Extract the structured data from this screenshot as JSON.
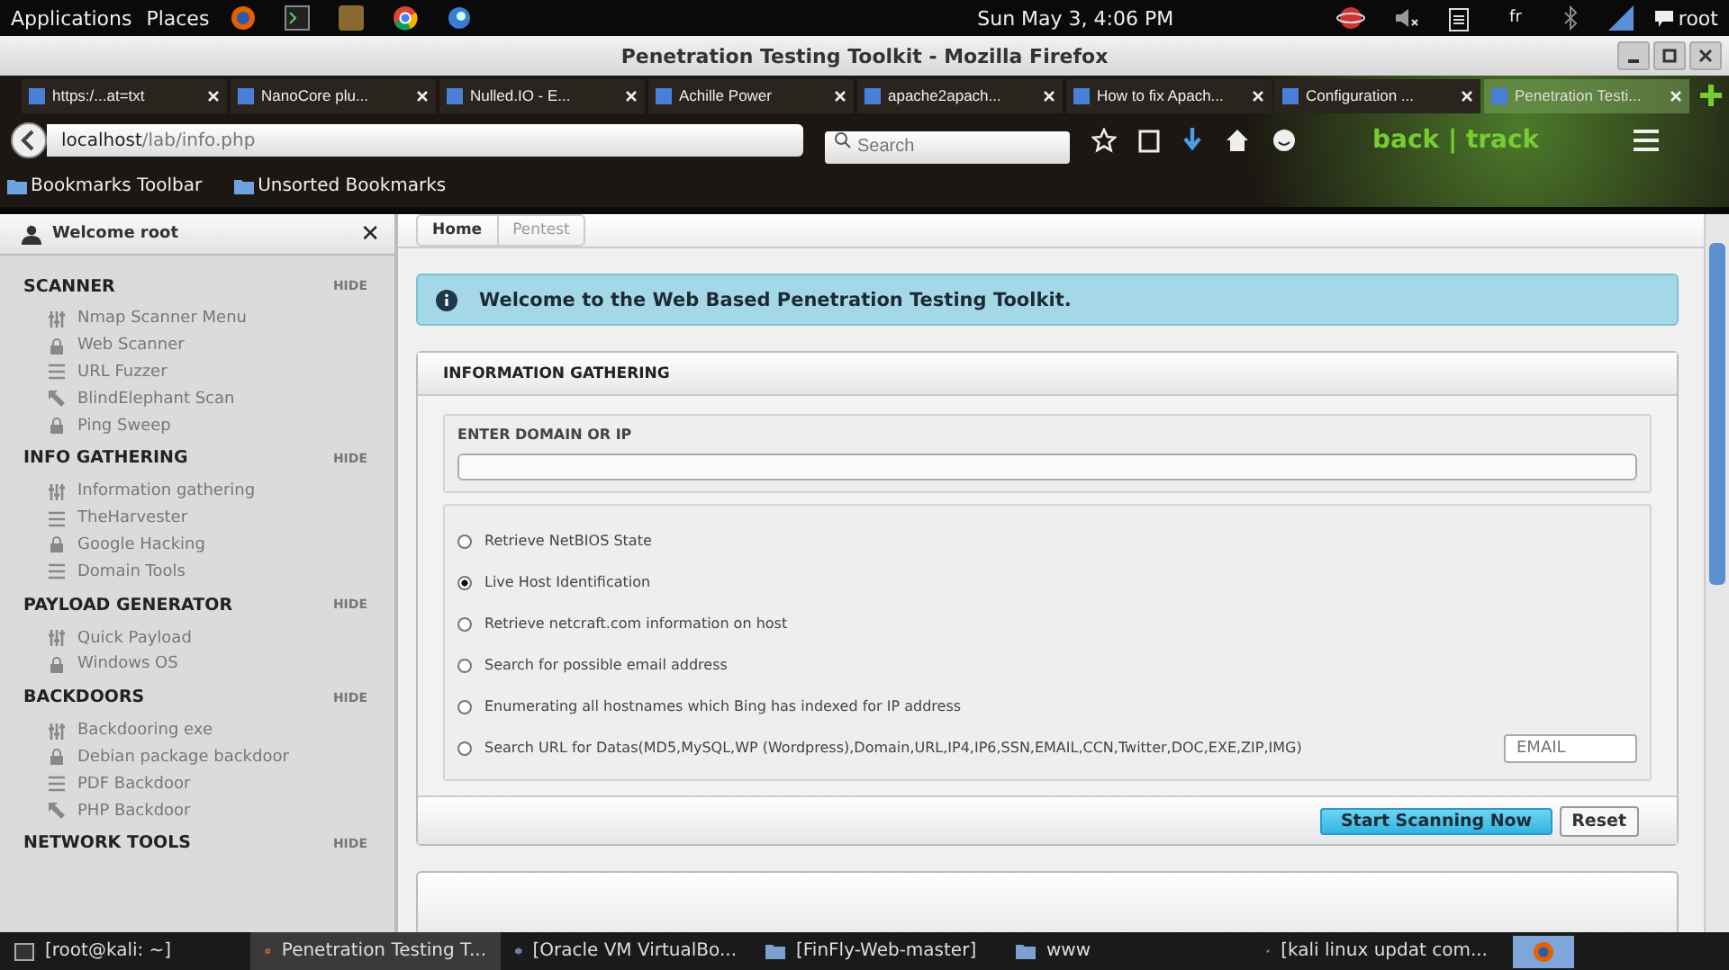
{
  "top_panel": {
    "menus": [
      "Applications",
      "Places"
    ],
    "clock": "Sun May  3,  4:06 PM",
    "keyboard": "fr",
    "user": "root"
  },
  "window": {
    "title": "Penetration Testing Toolkit - Mozilla Firefox"
  },
  "tabs": [
    {
      "label": "https:/...at=txt",
      "selected": false
    },
    {
      "label": "NanoCore plu...",
      "selected": false
    },
    {
      "label": "Nulled.IO - E...",
      "selected": false
    },
    {
      "label": "Achille Power",
      "selected": false
    },
    {
      "label": "apache2apach...",
      "selected": false
    },
    {
      "label": "How to fix Apach...",
      "selected": false
    },
    {
      "label": "Configuration ...",
      "selected": false
    },
    {
      "label": "Penetration Testi...",
      "selected": true
    }
  ],
  "nav": {
    "url_host": "localhost",
    "url_path": "/lab/info.php",
    "search_placeholder": "Search",
    "logo": "back | track"
  },
  "bookmarks": [
    "Bookmarks Toolbar",
    "Unsorted Bookmarks"
  ],
  "sidebar": {
    "welcome": "Welcome root",
    "close": "✕",
    "sections": [
      {
        "title": "SCANNER",
        "toggle": "HIDE",
        "items": [
          {
            "label": "Nmap Scanner Menu",
            "kind": "sliders"
          },
          {
            "label": "Web Scanner",
            "kind": "lock"
          },
          {
            "label": "URL Fuzzer",
            "kind": "list"
          },
          {
            "label": "BlindElephant Scan",
            "kind": "arrow"
          },
          {
            "label": "Ping Sweep",
            "kind": "lock"
          }
        ]
      },
      {
        "title": "INFO GATHERING",
        "toggle": "HIDE",
        "items": [
          {
            "label": "Information gathering",
            "kind": "sliders"
          },
          {
            "label": "TheHarvester",
            "kind": "list"
          },
          {
            "label": "Google Hacking",
            "kind": "lock"
          },
          {
            "label": "Domain Tools",
            "kind": "list"
          }
        ]
      },
      {
        "title": "PAYLOAD GENERATOR",
        "toggle": "HIDE",
        "items": [
          {
            "label": "Quick Payload",
            "kind": "sliders"
          },
          {
            "label": "Windows OS",
            "kind": "lock"
          }
        ]
      },
      {
        "title": "BACKDOORS",
        "toggle": "HIDE",
        "items": [
          {
            "label": "Backdooring exe",
            "kind": "sliders"
          },
          {
            "label": "Debian package backdoor",
            "kind": "lock"
          },
          {
            "label": "PDF Backdoor",
            "kind": "list"
          },
          {
            "label": "PHP Backdoor",
            "kind": "arrow"
          }
        ]
      },
      {
        "title": "NETWORK TOOLS",
        "toggle": "HIDE"
      }
    ]
  },
  "breadcrumb": [
    {
      "label": "Home",
      "selected": true
    },
    {
      "label": "Pentest",
      "selected": false
    }
  ],
  "alert": "Welcome to the Web Based Penetration Testing Toolkit.",
  "panel": {
    "title": "INFORMATION GATHERING",
    "field_label": "ENTER DOMAIN OR IP",
    "options": [
      {
        "label": "Retrieve NetBIOS State",
        "selected": false
      },
      {
        "label": "Live Host Identification",
        "selected": true
      },
      {
        "label": "Retrieve netcraft.com information on host",
        "selected": false
      },
      {
        "label": "Search for possible email address",
        "selected": false
      },
      {
        "label": "Enumerating all hostnames which Bing has indexed for IP address",
        "selected": false
      },
      {
        "label": "Search URL for Datas(MD5,MySQL,WP (Wordpress),Domain,URL,IP4,IP6,SSN,EMAIL,CCN,Twitter,DOC,EXE,ZIP,IMG)",
        "selected": false
      }
    ],
    "email_placeholder": "EMAIL",
    "primary_button": "Start Scanning Now",
    "reset_button": "Reset"
  },
  "taskbar": [
    {
      "label": "[root@kali: ~]",
      "kind": "terminal",
      "selected": false
    },
    {
      "label": "Penetration Testing T...",
      "kind": "firefox",
      "selected": true
    },
    {
      "label": "[Oracle VM VirtualBo...",
      "kind": "cube",
      "selected": false
    },
    {
      "label": "[FinFly-Web-master]",
      "kind": "folder",
      "selected": false
    },
    {
      "label": "www",
      "kind": "folder",
      "selected": false
    },
    {
      "label": "[kali linux updat com...",
      "kind": "leaf",
      "selected": false
    }
  ]
}
